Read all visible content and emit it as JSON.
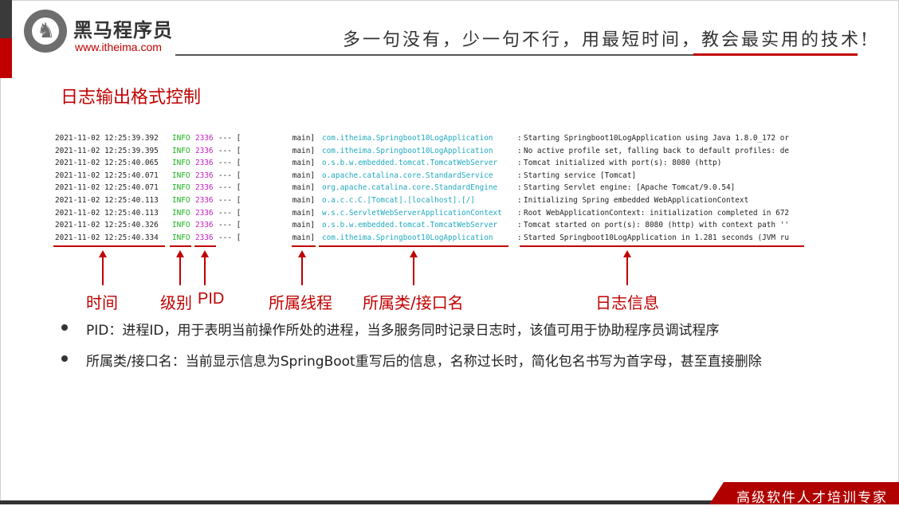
{
  "header": {
    "brand_cn": "黑马程序员",
    "brand_url": "www.itheima.com",
    "slogan": "多一句没有，少一句不行，用最短时间，教会最实用的技术!"
  },
  "page_title": "日志输出格式控制",
  "log_rows": [
    {
      "time": "2021-11-02 12:25:39.392",
      "level": "INFO",
      "pid": "2336",
      "sep": "--- [",
      "thread": "main]",
      "cls": "com.itheima.Springboot10LogApplication",
      "colon": ":",
      "msg": "Starting Springboot10LogApplication using Java 1.8.0_172 or"
    },
    {
      "time": "2021-11-02 12:25:39.395",
      "level": "INFO",
      "pid": "2336",
      "sep": "--- [",
      "thread": "main]",
      "cls": "com.itheima.Springboot10LogApplication",
      "colon": ":",
      "msg": "No active profile set, falling back to default profiles: de"
    },
    {
      "time": "2021-11-02 12:25:40.065",
      "level": "INFO",
      "pid": "2336",
      "sep": "--- [",
      "thread": "main]",
      "cls": "o.s.b.w.embedded.tomcat.TomcatWebServer",
      "colon": ":",
      "msg": "Tomcat initialized with port(s): 8080 (http)"
    },
    {
      "time": "2021-11-02 12:25:40.071",
      "level": "INFO",
      "pid": "2336",
      "sep": "--- [",
      "thread": "main]",
      "cls": "o.apache.catalina.core.StandardService",
      "colon": ":",
      "msg": "Starting service [Tomcat]"
    },
    {
      "time": "2021-11-02 12:25:40.071",
      "level": "INFO",
      "pid": "2336",
      "sep": "--- [",
      "thread": "main]",
      "cls": "org.apache.catalina.core.StandardEngine",
      "colon": ":",
      "msg": "Starting Servlet engine: [Apache Tomcat/9.0.54]"
    },
    {
      "time": "2021-11-02 12:25:40.113",
      "level": "INFO",
      "pid": "2336",
      "sep": "--- [",
      "thread": "main]",
      "cls": "o.a.c.c.C.[Tomcat].[localhost].[/]",
      "colon": ":",
      "msg": "Initializing Spring embedded WebApplicationContext"
    },
    {
      "time": "2021-11-02 12:25:40.113",
      "level": "INFO",
      "pid": "2336",
      "sep": "--- [",
      "thread": "main]",
      "cls": "w.s.c.ServletWebServerApplicationContext",
      "colon": ":",
      "msg": "Root WebApplicationContext: initialization completed in 672"
    },
    {
      "time": "2021-11-02 12:25:40.326",
      "level": "INFO",
      "pid": "2336",
      "sep": "--- [",
      "thread": "main]",
      "cls": "o.s.b.w.embedded.tomcat.TomcatWebServer",
      "colon": ":",
      "msg": "Tomcat started on port(s): 8080 (http) with context path ''"
    },
    {
      "time": "2021-11-02 12:25:40.334",
      "level": "INFO",
      "pid": "2336",
      "sep": "--- [",
      "thread": "main]",
      "cls": "com.itheima.Springboot10LogApplication",
      "colon": ":",
      "msg": "Started Springboot10LogApplication in 1.281 seconds (JVM ru"
    }
  ],
  "labels": {
    "time": "时间",
    "level": "级别",
    "pid": "PID",
    "thread": "所属线程",
    "cls": "所属类/接口名",
    "msg": "日志信息"
  },
  "bullets": [
    "PID：进程ID，用于表明当前操作所处的进程，当多服务同时记录日志时，该值可用于协助程序员调试程序",
    "所属类/接口名：当前显示信息为SpringBoot重写后的信息，名称过长时，简化包名书写为首字母，甚至直接删除"
  ],
  "footer": "高级软件人才培训专家",
  "colors": {
    "accent": "#c00000",
    "level": "#1fb01f",
    "pid": "#c020c0",
    "cls": "#20aac0"
  }
}
